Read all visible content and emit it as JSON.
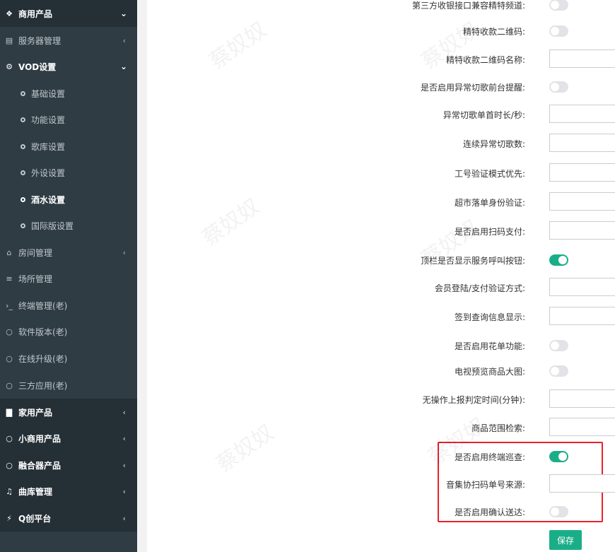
{
  "sidebar": {
    "top_group": {
      "label": "商用产品",
      "icon": "cubes-icon"
    },
    "items": [
      {
        "label": "服务器管理",
        "icon": "server-icon"
      },
      {
        "label": "VOD设置",
        "icon": "gears-icon"
      },
      {
        "label": "基础设置"
      },
      {
        "label": "功能设置"
      },
      {
        "label": "歌库设置"
      },
      {
        "label": "外设设置"
      },
      {
        "label": "酒水设置"
      },
      {
        "label": "国际版设置"
      },
      {
        "label": "房间管理",
        "icon": "bank-icon"
      },
      {
        "label": "场所管理",
        "icon": "list-icon"
      },
      {
        "label": "终端管理(老)",
        "icon": "terminal-icon"
      },
      {
        "label": "软件版本(老)",
        "icon": "circle-icon"
      },
      {
        "label": "在线升级(老)",
        "icon": "circle-icon"
      },
      {
        "label": "三方应用(老)",
        "icon": "circle-icon"
      },
      {
        "label": "家用产品",
        "icon": "file-icon"
      },
      {
        "label": "小商用产品",
        "icon": "circle-icon"
      },
      {
        "label": "融合器产品",
        "icon": "circle-icon"
      },
      {
        "label": "曲库管理",
        "icon": "music-icon"
      },
      {
        "label": "Q创平台",
        "icon": "plug-icon"
      }
    ]
  },
  "form": {
    "rows": [
      {
        "label": "第三方收银接口兼容精特频道:",
        "type": "toggle",
        "on": false
      },
      {
        "label": "精特收款二维码:",
        "type": "toggle",
        "on": false
      },
      {
        "label": "精特收款二维码名称:",
        "type": "input",
        "value": ""
      },
      {
        "label": "是否启用异常切歌前台提醒:",
        "type": "toggle",
        "on": false
      },
      {
        "label": "异常切歌单首时长/秒:",
        "type": "input",
        "value": ""
      },
      {
        "label": "连续异常切歌数:",
        "type": "input",
        "value": ""
      },
      {
        "label": "工号验证模式优先:",
        "type": "input",
        "value": ""
      },
      {
        "label": "超市落单身份验证:",
        "type": "input",
        "value": ""
      },
      {
        "label": "是否启用扫码支付:",
        "type": "input",
        "value": ""
      },
      {
        "label": "顶栏是否显示服务呼叫按钮:",
        "type": "toggle",
        "on": true
      },
      {
        "label": "会员登陆/支付验证方式:",
        "type": "input",
        "value": ""
      },
      {
        "label": "签到查询信息显示:",
        "type": "input",
        "value": ""
      },
      {
        "label": "是否启用花单功能:",
        "type": "toggle",
        "on": false
      },
      {
        "label": "电视预览商品大图:",
        "type": "toggle",
        "on": false
      },
      {
        "label": "无操作上报判定时间(分钟):",
        "type": "input",
        "value": ""
      },
      {
        "label": "商品范围检索:",
        "type": "input",
        "value": ""
      },
      {
        "label": "是否启用终端巡查:",
        "type": "toggle",
        "on": true
      },
      {
        "label": "音集协扫码单号来源:",
        "type": "input",
        "value": ""
      },
      {
        "label": "是否启用确认送达:",
        "type": "toggle",
        "on": false
      }
    ],
    "save_label": "保存"
  },
  "colors": {
    "accent": "#1aae88",
    "sidebar_bg": "#2f3c44",
    "highlight": "#e8202a"
  },
  "watermark": "蔡奴奴"
}
